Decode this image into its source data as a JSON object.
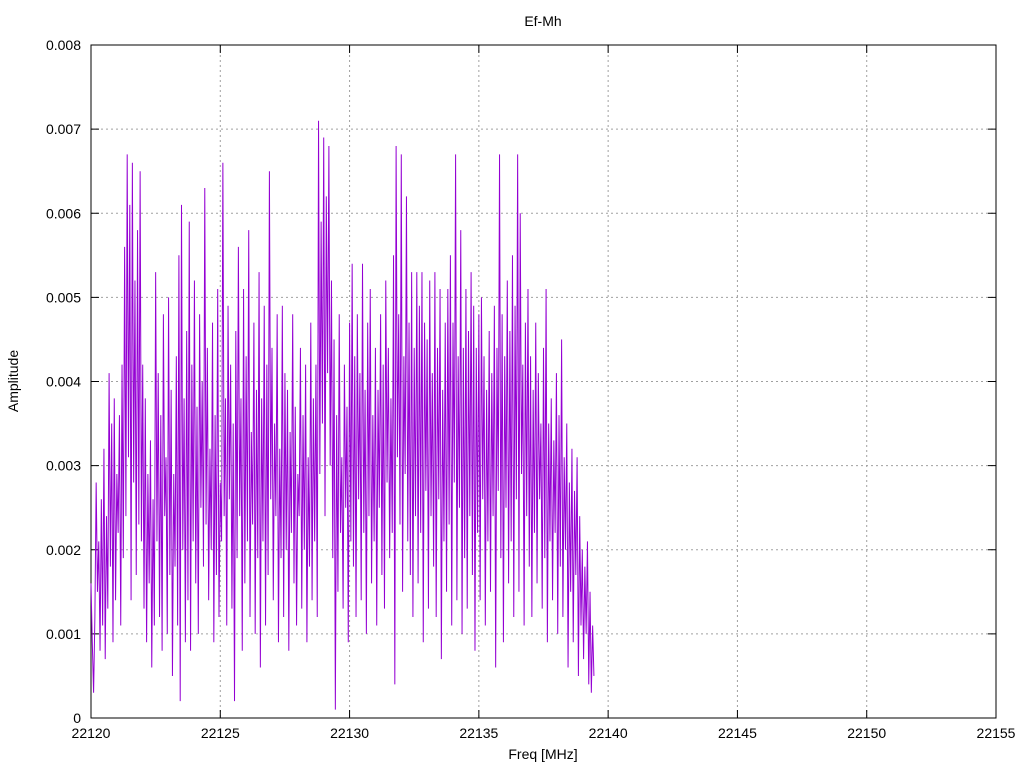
{
  "chart_data": {
    "type": "line",
    "title": "Ef-Mh",
    "xlabel": "Freq [MHz]",
    "ylabel": "Amplitude",
    "xlim": [
      22120,
      22155
    ],
    "ylim": [
      0,
      0.008
    ],
    "x_ticks": [
      "22120",
      "22125",
      "22130",
      "22135",
      "22140",
      "22145",
      "22150",
      "22155"
    ],
    "y_ticks": [
      "0",
      "0.001",
      "0.002",
      "0.003",
      "0.004",
      "0.005",
      "0.006",
      "0.007",
      "0.008"
    ],
    "grid": true,
    "line_color": "#9400d3",
    "series": [
      {
        "x_start": 22120,
        "x_step": 0.05,
        "values": [
          0.0016,
          0.0009,
          0.0003,
          0.0012,
          0.0028,
          0.0015,
          0.0021,
          0.0008,
          0.0026,
          0.0011,
          0.0032,
          0.0007,
          0.0024,
          0.0013,
          0.0041,
          0.0018,
          0.0035,
          0.0009,
          0.0038,
          0.0014,
          0.0029,
          0.0022,
          0.0036,
          0.0011,
          0.0042,
          0.0019,
          0.0056,
          0.0024,
          0.0067,
          0.0031,
          0.0061,
          0.0014,
          0.0066,
          0.0028,
          0.0052,
          0.0017,
          0.0058,
          0.0023,
          0.0065,
          0.0021,
          0.0042,
          0.0013,
          0.0038,
          0.0009,
          0.0029,
          0.0016,
          0.0033,
          0.0006,
          0.0026,
          0.0011,
          0.0053,
          0.0021,
          0.0041,
          0.0012,
          0.0036,
          0.0008,
          0.0048,
          0.0024,
          0.0031,
          0.001,
          0.005,
          0.0017,
          0.0039,
          0.0005,
          0.0029,
          0.0018,
          0.0043,
          0.0011,
          0.0055,
          0.0002,
          0.0061,
          0.002,
          0.0038,
          0.0009,
          0.0046,
          0.0014,
          0.0059,
          0.0008,
          0.0042,
          0.0021,
          0.0052,
          0.0016,
          0.0037,
          0.001,
          0.0048,
          0.0025,
          0.004,
          0.0018,
          0.0063,
          0.0023,
          0.0044,
          0.0014,
          0.0032,
          0.002,
          0.0047,
          0.0009,
          0.0036,
          0.0017,
          0.0051,
          0.0012,
          0.0028,
          0.0021,
          0.0066,
          0.0024,
          0.0038,
          0.0011,
          0.0049,
          0.0026,
          0.0042,
          0.0013,
          0.0035,
          0.0002,
          0.0046,
          0.0019,
          0.0056,
          0.0024,
          0.0038,
          0.0008,
          0.0051,
          0.0016,
          0.0043,
          0.0021,
          0.0058,
          0.0012,
          0.0034,
          0.0023,
          0.0047,
          0.001,
          0.0039,
          0.0019,
          0.0053,
          0.0006,
          0.0038,
          0.0021,
          0.0049,
          0.0011,
          0.0042,
          0.0017,
          0.0065,
          0.0026,
          0.0044,
          0.0014,
          0.0035,
          0.0024,
          0.0048,
          0.0009,
          0.0032,
          0.0019,
          0.0049,
          0.0012,
          0.0041,
          0.002,
          0.0039,
          0.0008,
          0.0034,
          0.0022,
          0.0048,
          0.0016,
          0.0037,
          0.0011,
          0.0029,
          0.0024,
          0.0044,
          0.0013,
          0.0036,
          0.002,
          0.0042,
          0.0009,
          0.0031,
          0.0018,
          0.0047,
          0.0014,
          0.0038,
          0.0021,
          0.0042,
          0.0012,
          0.0071,
          0.0029,
          0.0059,
          0.0035,
          0.0069,
          0.0024,
          0.0062,
          0.0041,
          0.0068,
          0.003,
          0.0052,
          0.0019,
          0.0045,
          0.0001,
          0.0036,
          0.0015,
          0.0048,
          0.0022,
          0.0031,
          0.0013,
          0.0042,
          0.0025,
          0.0037,
          0.0009,
          0.0047,
          0.0021,
          0.0054,
          0.0018,
          0.0043,
          0.0012,
          0.0048,
          0.0026,
          0.0041,
          0.0014,
          0.0054,
          0.0022,
          0.0039,
          0.001,
          0.0047,
          0.0024,
          0.0051,
          0.0016,
          0.0036,
          0.0021,
          0.0044,
          0.0011,
          0.0039,
          0.0025,
          0.0048,
          0.0017,
          0.0042,
          0.0013,
          0.0052,
          0.0028,
          0.0044,
          0.0019,
          0.0038,
          0.0022,
          0.0055,
          0.0004,
          0.0068,
          0.0031,
          0.0048,
          0.0023,
          0.0067,
          0.0015,
          0.0043,
          0.0029,
          0.0062,
          0.0021,
          0.0047,
          0.0017,
          0.0053,
          0.0012,
          0.0044,
          0.0024,
          0.0053,
          0.0016,
          0.0049,
          0.0022,
          0.0053,
          0.0009,
          0.0047,
          0.0027,
          0.0045,
          0.0013,
          0.0052,
          0.0024,
          0.0041,
          0.0018,
          0.0053,
          0.0012,
          0.0044,
          0.0026,
          0.0051,
          0.0007,
          0.0039,
          0.0021,
          0.0047,
          0.0015,
          0.0051,
          0.0023,
          0.0055,
          0.0011,
          0.0047,
          0.0028,
          0.0067,
          0.0014,
          0.0043,
          0.0025,
          0.0058,
          0.001,
          0.0044,
          0.0019,
          0.0051,
          0.0013,
          0.0046,
          0.0024,
          0.0053,
          0.0017,
          0.0049,
          0.0008,
          0.0044,
          0.0022,
          0.0048,
          0.0014,
          0.005,
          0.0026,
          0.0043,
          0.0011,
          0.0039,
          0.0021,
          0.0046,
          0.0015,
          0.0041,
          0.0024,
          0.0049,
          0.0006,
          0.0044,
          0.0027,
          0.0067,
          0.0019,
          0.0048,
          0.0009,
          0.0043,
          0.0025,
          0.0052,
          0.0016,
          0.0046,
          0.0021,
          0.0055,
          0.0012,
          0.0049,
          0.0026,
          0.0067,
          0.0015,
          0.006,
          0.0029,
          0.0042,
          0.0011,
          0.0047,
          0.0024,
          0.0051,
          0.0018,
          0.0043,
          0.0012,
          0.0039,
          0.0022,
          0.0047,
          0.0016,
          0.0041,
          0.0026,
          0.0035,
          0.0013,
          0.0044,
          0.0019,
          0.0051,
          0.0009,
          0.0035,
          0.0021,
          0.0038,
          0.0014,
          0.0033,
          0.0022,
          0.0041,
          0.001,
          0.0036,
          0.0018,
          0.0045,
          0.0012,
          0.0031,
          0.002,
          0.0035,
          0.0006,
          0.0028,
          0.0015,
          0.0032,
          0.0009,
          0.0027,
          0.0017,
          0.0031,
          0.0005,
          0.0024,
          0.0011,
          0.002,
          0.0007,
          0.0018,
          0.001,
          0.0021,
          0.0004,
          0.0015,
          0.0003,
          0.0011,
          0.0005
        ]
      }
    ]
  }
}
